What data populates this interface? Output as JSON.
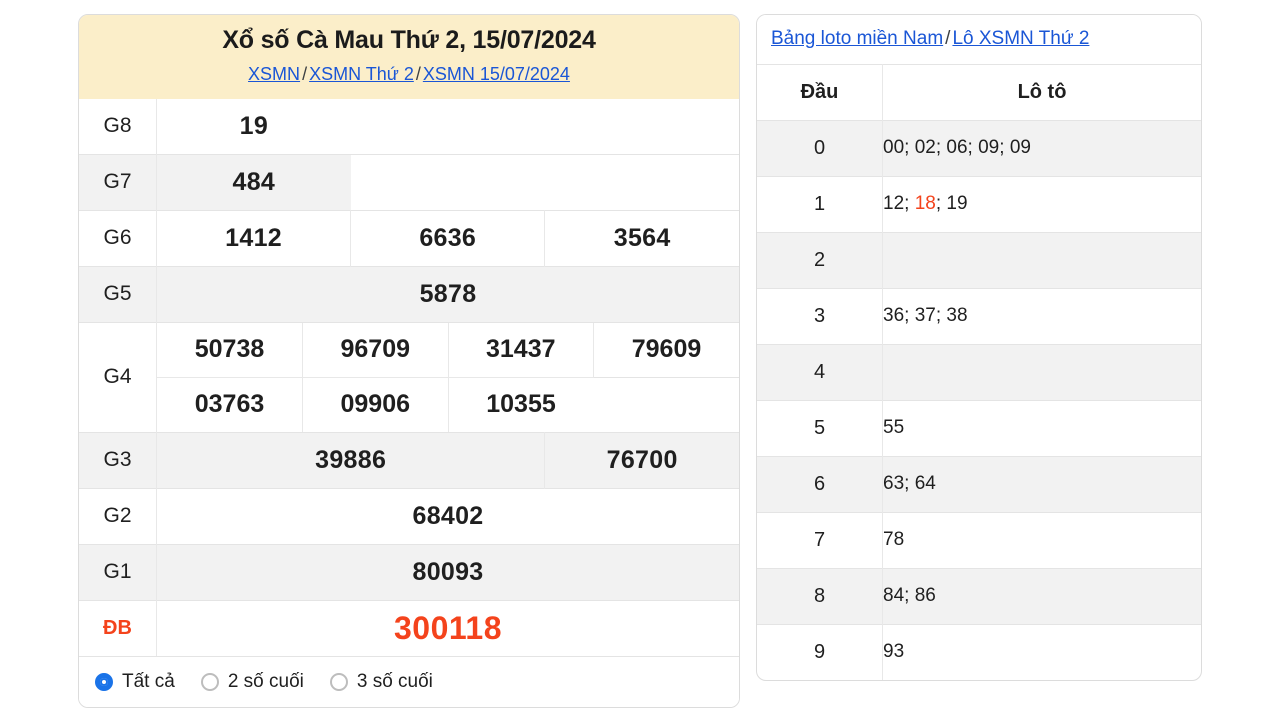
{
  "result_card": {
    "title": "Xổ số Cà Mau Thứ 2, 15/07/2024",
    "breadcrumb": {
      "item1": "XSMN",
      "sep1": "/",
      "item2": "XSMN Thứ 2",
      "sep2": "/",
      "item3": "XSMN 15/07/2024"
    },
    "prizes": [
      {
        "label": "G8",
        "values": [
          "19"
        ]
      },
      {
        "label": "G7",
        "values": [
          "484"
        ]
      },
      {
        "label": "G6",
        "values": [
          "1412",
          "6636",
          "3564"
        ]
      },
      {
        "label": "G5",
        "values": [
          "5878"
        ]
      },
      {
        "label": "G4",
        "values": [
          "50738",
          "96709",
          "31437",
          "79609",
          "03763",
          "09906",
          "10355"
        ]
      },
      {
        "label": "G3",
        "values": [
          "39886",
          "76700"
        ]
      },
      {
        "label": "G2",
        "values": [
          "68402"
        ]
      },
      {
        "label": "G1",
        "values": [
          "80093"
        ]
      },
      {
        "label": "ĐB",
        "values": [
          "300118"
        ]
      }
    ],
    "filters": [
      {
        "label": "Tất cả",
        "selected": true
      },
      {
        "label": "2 số cuối",
        "selected": false
      },
      {
        "label": "3 số cuối",
        "selected": false
      }
    ]
  },
  "loto_card": {
    "breadcrumb": {
      "item1": "Bảng loto miền Nam",
      "sep1": "/",
      "item2": "Lô XSMN Thứ 2"
    },
    "columns": {
      "head": "Đầu",
      "values": "Lô tô"
    },
    "rows": [
      {
        "dau": "0",
        "numbers": [
          "00",
          "02",
          "06",
          "09",
          "09"
        ],
        "highlight": []
      },
      {
        "dau": "1",
        "numbers": [
          "12",
          "18",
          "19"
        ],
        "highlight": [
          "18"
        ]
      },
      {
        "dau": "2",
        "numbers": [],
        "highlight": []
      },
      {
        "dau": "3",
        "numbers": [
          "36",
          "37",
          "38"
        ],
        "highlight": []
      },
      {
        "dau": "4",
        "numbers": [],
        "highlight": []
      },
      {
        "dau": "5",
        "numbers": [
          "55"
        ],
        "highlight": []
      },
      {
        "dau": "6",
        "numbers": [
          "63",
          "64"
        ],
        "highlight": []
      },
      {
        "dau": "7",
        "numbers": [
          "78"
        ],
        "highlight": []
      },
      {
        "dau": "8",
        "numbers": [
          "84",
          "86"
        ],
        "highlight": []
      },
      {
        "dau": "9",
        "numbers": [
          "93"
        ],
        "highlight": []
      }
    ]
  },
  "colors": {
    "header_bg": "#fbeec9",
    "link": "#1a56d6",
    "special_prize": "#f4431c",
    "radio_selected": "#1a73e8",
    "row_stripe": "#f2f2f2"
  }
}
